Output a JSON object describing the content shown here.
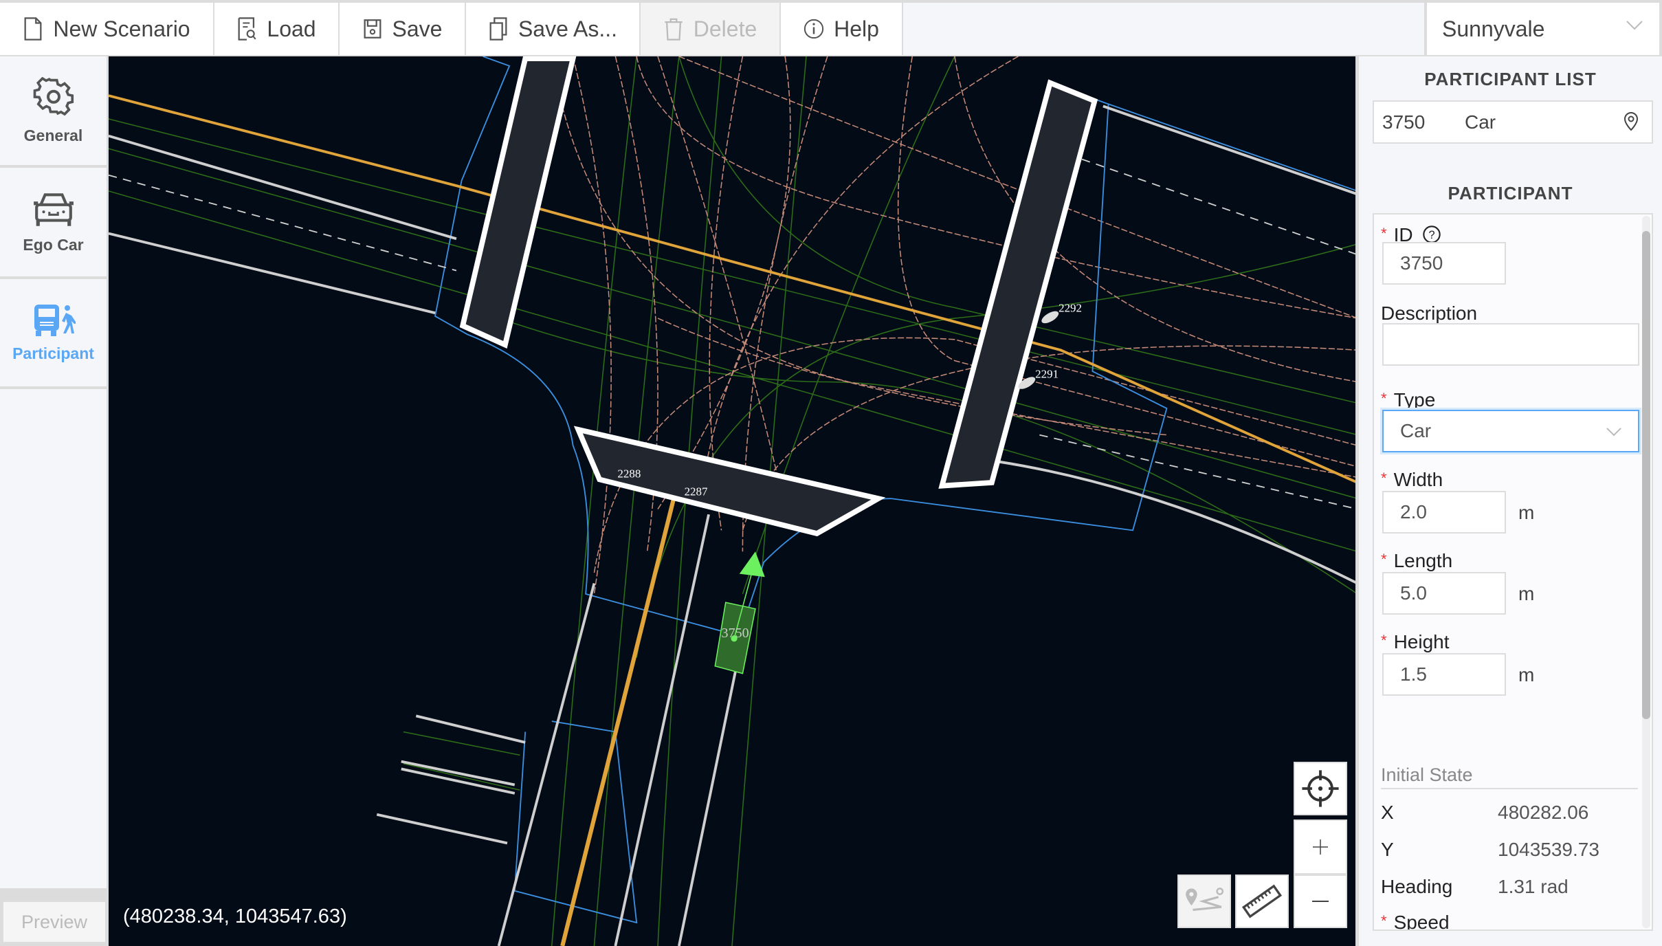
{
  "toolbar": {
    "new_scenario": "New Scenario",
    "load": "Load",
    "save": "Save",
    "save_as": "Save As...",
    "delete": "Delete",
    "help": "Help",
    "city": "Sunnyvale"
  },
  "sidebar": {
    "items": [
      {
        "label": "General",
        "icon": "gear-icon"
      },
      {
        "label": "Ego Car",
        "icon": "car-icon"
      },
      {
        "label": "Participant",
        "icon": "participant-icon",
        "active": true
      }
    ],
    "preview": "Preview"
  },
  "map": {
    "cursor_coords": "(480238.34, 1043547.63)",
    "labels": [
      "2292",
      "2291",
      "2288",
      "2287",
      "3750"
    ],
    "colors": {
      "background": "#020b16",
      "lane_center": "#e0a43a",
      "boundary": "#ffffff",
      "junction": "#3b8fe0",
      "participant": "#6cf060"
    }
  },
  "panel": {
    "list_title": "PARTICIPANT LIST",
    "list": [
      {
        "id": "3750",
        "type": "Car"
      }
    ],
    "participant_title": "PARTICIPANT",
    "id_label": "ID",
    "id_value": "3750",
    "description_label": "Description",
    "description_value": "",
    "type_label": "Type",
    "type_value": "Car",
    "width_label": "Width",
    "width_value": "2.0",
    "length_label": "Length",
    "length_value": "5.0",
    "height_label": "Height",
    "height_value": "1.5",
    "unit": "m",
    "initial_state": "Initial State",
    "x_label": "X",
    "x_value": "480282.06",
    "y_label": "Y",
    "y_value": "1043539.73",
    "heading_label": "Heading",
    "heading_value": "1.31 rad",
    "speed_label": "Speed",
    "accent": "#5aa7f5"
  }
}
